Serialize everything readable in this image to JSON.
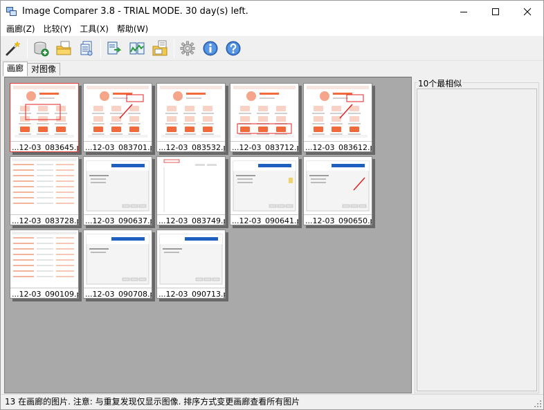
{
  "window": {
    "title": "Image Comparer 3.8 - TRIAL MODE. 30 day(s) left.",
    "controls": [
      "minimize",
      "maximize",
      "close"
    ]
  },
  "menu": {
    "items": [
      "画廊(Z)",
      "比较(Y)",
      "工具(X)",
      "帮助(W)"
    ]
  },
  "toolbar": {
    "buttons": [
      {
        "name": "wizard-icon"
      },
      {
        "name": "add-database-icon"
      },
      {
        "name": "open-folder-icon"
      },
      {
        "name": "scan-icon"
      },
      {
        "name": "compare-icon"
      },
      {
        "name": "compare-pair-icon"
      },
      {
        "name": "folder-files-icon"
      },
      {
        "name": "settings-gear-icon"
      },
      {
        "name": "info-icon"
      },
      {
        "name": "help-icon"
      }
    ]
  },
  "tabs": [
    {
      "label": "画廊",
      "active": true
    },
    {
      "label": "对图像",
      "active": false
    }
  ],
  "gallery": {
    "thumbnails": [
      {
        "caption": "...12-03_083645.png",
        "selected": true,
        "kind": "phone-red"
      },
      {
        "caption": "...12-03_083701.png",
        "selected": false,
        "kind": "phone-arrow"
      },
      {
        "caption": "...12-03_083532.png",
        "selected": false,
        "kind": "phone"
      },
      {
        "caption": "...12-03_083712.png",
        "selected": false,
        "kind": "phone-box"
      },
      {
        "caption": "...12-03_083612.png",
        "selected": false,
        "kind": "phone-arrow"
      },
      {
        "caption": "...12-03_083728.png",
        "selected": false,
        "kind": "list"
      },
      {
        "caption": "...12-03_090637.png",
        "selected": false,
        "kind": "dialog"
      },
      {
        "caption": "...12-03_083749.png",
        "selected": false,
        "kind": "blank"
      },
      {
        "caption": "...12-03_090641.png",
        "selected": false,
        "kind": "dialog-small"
      },
      {
        "caption": "...12-03_090650.png",
        "selected": false,
        "kind": "dialog-arrow"
      },
      {
        "caption": "...12-03_090109.png",
        "selected": false,
        "kind": "list"
      },
      {
        "caption": "...12-03_090708.png",
        "selected": false,
        "kind": "dialog-plain"
      },
      {
        "caption": "...12-03_090713.png",
        "selected": false,
        "kind": "dialog-plain"
      }
    ]
  },
  "right_panel": {
    "title": "10个最相似"
  },
  "status": {
    "text": "13 在画廊的图片. 注意: 与重复发现仅显示图像. 排序方式变更画廊查看所有图片"
  },
  "colors": {
    "gallery_bg": "#a9a9a9",
    "selected_border": "#e23a3a",
    "accent_orange": "#f26a3c",
    "accent_blue": "#1f5fbf"
  }
}
